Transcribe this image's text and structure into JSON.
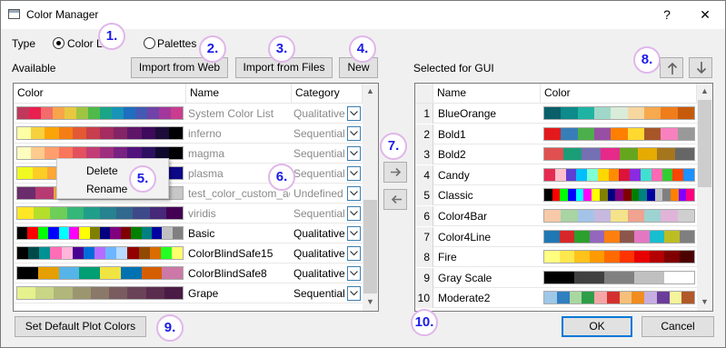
{
  "window": {
    "title": "Color Manager",
    "help_symbol": "?",
    "close_symbol": "✕"
  },
  "type_row": {
    "label": "Type",
    "option_color_lists": "Color Lists",
    "option_palettes": "Palettes",
    "selected": "Color Lists"
  },
  "left": {
    "available_label": "Available",
    "btn_import_web": "Import from Web",
    "btn_import_files": "Import from Files",
    "btn_new": "New",
    "columns": [
      "Color",
      "Name",
      "Category"
    ],
    "rows": [
      {
        "name": "System Color List",
        "category": "Qualitative",
        "disabled": true,
        "colors": [
          "#c0395c",
          "#e8204f",
          "#f36b6b",
          "#f7a44a",
          "#e8c840",
          "#9ec441",
          "#4fb94a",
          "#1aa586",
          "#1894b8",
          "#1f6ec0",
          "#4459b3",
          "#7142a7",
          "#a3379c",
          "#c93d8f"
        ]
      },
      {
        "name": "inferno",
        "category": "Sequential",
        "disabled": true,
        "colors": [
          "#fcffa4",
          "#f7d13d",
          "#fba40a",
          "#f57d15",
          "#e35933",
          "#c73e4c",
          "#a52c60",
          "#832467",
          "#5f1668",
          "#3e0a5c",
          "#1d0c3a",
          "#000004"
        ]
      },
      {
        "name": "magma",
        "category": "Sequential",
        "disabled": true,
        "colors": [
          "#fcfdbf",
          "#feca8d",
          "#fe9f6d",
          "#f8765c",
          "#e4515e",
          "#c23d75",
          "#9e2f7f",
          "#782281",
          "#51127c",
          "#2d1160",
          "#10092d",
          "#000004"
        ]
      },
      {
        "name": "plasma",
        "category": "Sequential",
        "disabled": true,
        "colors": [
          "#f0f921",
          "#fccd25",
          "#fca636",
          "#f2844b",
          "#e16462",
          "#cc4778",
          "#b12a90",
          "#8f0da4",
          "#6a00a8",
          "#41049d",
          "#0d0887"
        ]
      },
      {
        "name": "test_color_custom_add",
        "category": "Undefined",
        "disabled": true,
        "colors": [
          "#6b2c6b",
          "#b83a72",
          "#e6a23c",
          "#9ec441",
          "#4fb94a",
          "#2d7f7f",
          "#3f6fb0",
          "#7a4ea3",
          "#c7c7c7"
        ]
      },
      {
        "name": "viridis",
        "category": "Sequential",
        "disabled": true,
        "colors": [
          "#fde725",
          "#b5de2b",
          "#6ece58",
          "#35b779",
          "#1f9e89",
          "#26828e",
          "#31688e",
          "#3e4989",
          "#482878",
          "#440154"
        ]
      },
      {
        "name": "Basic",
        "category": "Qualitative",
        "disabled": false,
        "colors": [
          "#000000",
          "#ff0000",
          "#00ff00",
          "#0000ff",
          "#00ffff",
          "#ff00ff",
          "#ffff00",
          "#808000",
          "#000080",
          "#800080",
          "#800000",
          "#008000",
          "#008080",
          "#0000a0",
          "#c0c0c0",
          "#808080"
        ]
      },
      {
        "name": "ColorBlindSafe15",
        "category": "Qualitative",
        "disabled": false,
        "colors": [
          "#000000",
          "#004949",
          "#009292",
          "#ff6db6",
          "#ffb6db",
          "#490092",
          "#006ddb",
          "#b66dff",
          "#6db6ff",
          "#b6dbff",
          "#920000",
          "#924900",
          "#db6d00",
          "#24ff24",
          "#ffff6d"
        ]
      },
      {
        "name": "ColorBlindSafe8",
        "category": "Qualitative",
        "disabled": false,
        "colors": [
          "#000000",
          "#e69f00",
          "#56b4e9",
          "#009e73",
          "#f0e442",
          "#0072b2",
          "#d55e00",
          "#cc79a7"
        ]
      },
      {
        "name": "Grape",
        "category": "Sequential",
        "disabled": false,
        "colors": [
          "#e5f28e",
          "#c9d685",
          "#b1b67a",
          "#9c9670",
          "#8a7868",
          "#7a5c60",
          "#6a4258",
          "#5a2c4e",
          "#4a1b44"
        ]
      }
    ]
  },
  "context_menu": {
    "items": [
      "Delete",
      "Rename"
    ]
  },
  "middle": {
    "add_arrow": "→",
    "remove_arrow": "←"
  },
  "right": {
    "selected_label": "Selected for GUI",
    "up_arrow": "↑",
    "down_arrow": "↓",
    "columns": [
      "Name",
      "Color"
    ],
    "rows": [
      {
        "num": "1",
        "name": "BlueOrange",
        "colors": [
          "#0a5f6a",
          "#0e8a8a",
          "#1fb3a4",
          "#9fd8c8",
          "#d9ecd9",
          "#f7d7a0",
          "#f6a94d",
          "#f07d1b",
          "#c65a0b"
        ]
      },
      {
        "num": "2",
        "name": "Bold1",
        "colors": [
          "#e31a1c",
          "#377eb8",
          "#4daf4a",
          "#984ea3",
          "#ff7f00",
          "#ffd92f",
          "#a65628",
          "#f781bf",
          "#999999"
        ]
      },
      {
        "num": "3",
        "name": "Bold2",
        "colors": [
          "#e05050",
          "#1b9e77",
          "#7570b3",
          "#e7298a",
          "#66a61e",
          "#e6ab02",
          "#a6761d",
          "#666666"
        ]
      },
      {
        "num": "4",
        "name": "Candy",
        "colors": [
          "#e52b50",
          "#ffc0cb",
          "#5d3fd3",
          "#00bfff",
          "#7fffd4",
          "#ffd700",
          "#ff8c00",
          "#dc143c",
          "#8a2be2",
          "#40e0d0",
          "#ff69b4",
          "#32cd32",
          "#ff4500",
          "#1e90ff"
        ]
      },
      {
        "num": "5",
        "name": "Classic",
        "colors": [
          "#000000",
          "#ff0000",
          "#00ff00",
          "#0000ff",
          "#00ffff",
          "#ff00ff",
          "#ffff00",
          "#808000",
          "#000080",
          "#800080",
          "#800000",
          "#008000",
          "#008080",
          "#0000a0",
          "#c0c0c0",
          "#808080",
          "#ff8000",
          "#8000ff",
          "#ff0080"
        ]
      },
      {
        "num": "6",
        "name": "Color4Bar",
        "colors": [
          "#f7c9a9",
          "#a9d4a4",
          "#a3c4e8",
          "#c7b8e0",
          "#f4e38a",
          "#f0a38f",
          "#9dd3d0",
          "#e0b4d8",
          "#cfcfcf"
        ]
      },
      {
        "num": "7",
        "name": "Color4Line",
        "colors": [
          "#1f77b4",
          "#d62728",
          "#2ca02c",
          "#9467bd",
          "#ff7f0e",
          "#8c564b",
          "#e377c2",
          "#17becf",
          "#bcbd22",
          "#7f7f7f"
        ]
      },
      {
        "num": "8",
        "name": "Fire",
        "colors": [
          "#ffff80",
          "#ffe84d",
          "#ffc21a",
          "#ff9a00",
          "#ff6a00",
          "#ff3300",
          "#e60000",
          "#b30000",
          "#800000",
          "#4d0000"
        ]
      },
      {
        "num": "9",
        "name": "Gray Scale",
        "colors": [
          "#000000",
          "#404040",
          "#808080",
          "#c0c0c0",
          "#ffffff"
        ]
      },
      {
        "num": "10",
        "name": "Moderate2",
        "colors": [
          "#9ec7e8",
          "#2f7fc1",
          "#a8d8a0",
          "#2e9e48",
          "#f4a6a6",
          "#d43030",
          "#f7c07a",
          "#f08d1e",
          "#c6aee0",
          "#6a3d9a",
          "#f4f49b",
          "#b15928"
        ]
      }
    ]
  },
  "bottom": {
    "btn_set_default": "Set Default Plot Colors",
    "btn_ok": "OK",
    "btn_cancel": "Cancel"
  },
  "callouts": [
    "1.",
    "2.",
    "3.",
    "4.",
    "5.",
    "6.",
    "7.",
    "8.",
    "9.",
    "10."
  ]
}
